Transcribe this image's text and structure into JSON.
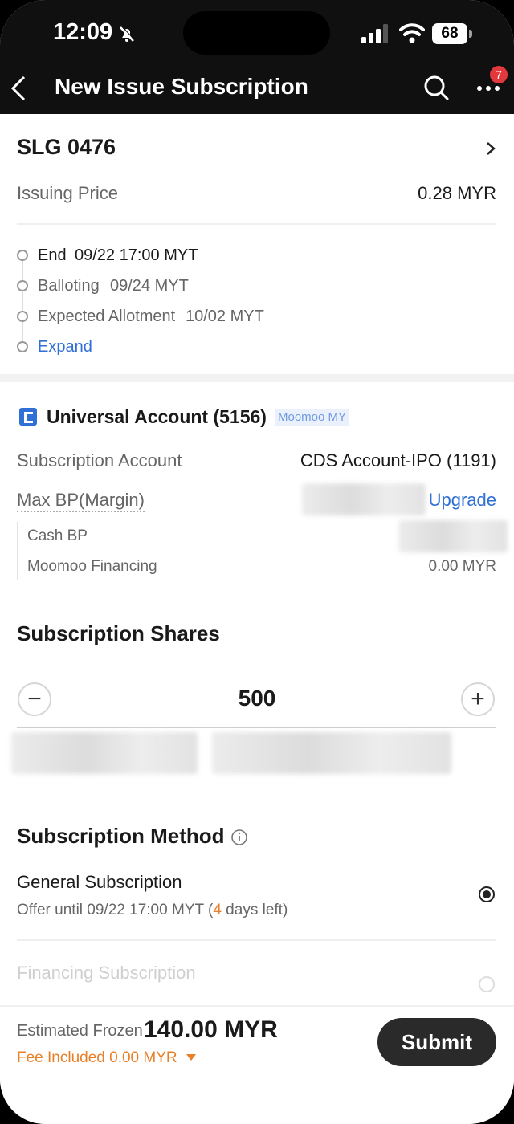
{
  "status_bar": {
    "time": "12:09",
    "battery": "68"
  },
  "nav": {
    "title": "New Issue Subscription",
    "notification_count": "7"
  },
  "stock": {
    "code": "SLG 0476",
    "issuing_price_label": "Issuing Price",
    "issuing_price_value": "0.28 MYR"
  },
  "timeline": [
    {
      "label": "End",
      "value": "09/22 17:00 MYT"
    },
    {
      "label": "Balloting",
      "value": "09/24 MYT"
    },
    {
      "label": "Expected Allotment",
      "value": "10/02 MYT"
    }
  ],
  "expand_label": "Expand",
  "account": {
    "name": "Universal Account (5156)",
    "tag": "Moomoo MY",
    "subscription_account_label": "Subscription Account",
    "subscription_account_value": "CDS Account-IPO (1191)",
    "max_bp_label": "Max BP(Margin)",
    "upgrade_label": "Upgrade",
    "cash_bp_label": "Cash BP",
    "financing_label": "Moomoo Financing",
    "financing_value": "0.00 MYR"
  },
  "shares": {
    "heading": "Subscription Shares",
    "value": "500",
    "minus": "−",
    "plus": "+"
  },
  "method": {
    "heading": "Subscription Method",
    "general_title": "General Subscription",
    "general_offer_prefix": "Offer until 09/22 17:00 MYT (",
    "general_days": "4",
    "general_offer_suffix": " days left)",
    "financing_title": "Financing Subscription"
  },
  "footer": {
    "estimated_label": "Estimated Frozen",
    "estimated_value": "140.00 MYR",
    "fee_label": "Fee Included 0.00 MYR",
    "submit_label": "Submit"
  }
}
